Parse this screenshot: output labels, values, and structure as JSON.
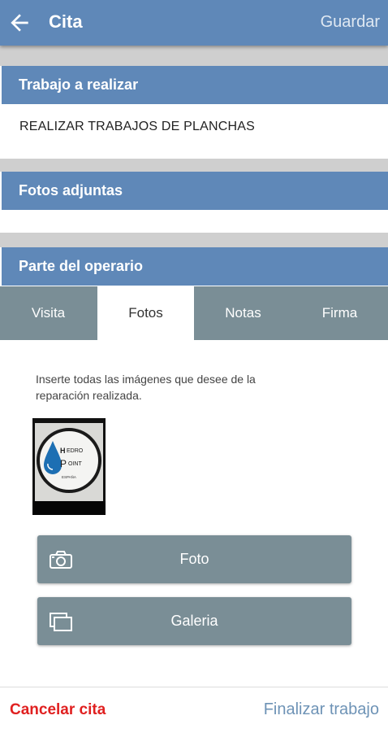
{
  "appbar": {
    "title": "Cita",
    "save_label": "Guardar"
  },
  "work": {
    "header": "Trabajo a realizar",
    "description": "REALIZAR TRABAJOS DE PLANCHAS"
  },
  "photos": {
    "header": "Fotos adjuntas"
  },
  "operator": {
    "header": "Parte del operario",
    "tabs": [
      {
        "label": "Visita"
      },
      {
        "label": "Fotos",
        "active": true
      },
      {
        "label": "Notas"
      },
      {
        "label": "Firma"
      }
    ],
    "hint": "Inserte todas las imágenes que desee de la reparación realizada.",
    "thumbnail_logo": {
      "line1": "EDRO",
      "line2": "OINT",
      "sub": "ESPAÑA"
    },
    "photo_button": "Foto",
    "gallery_button": "Galeria"
  },
  "footer": {
    "cancel_label": "Cancelar cita",
    "finish_label": "Finalizar trabajo"
  },
  "colors": {
    "primary": "#5f88b8",
    "tab_bg": "#7a8e96",
    "danger": "#e02020"
  }
}
